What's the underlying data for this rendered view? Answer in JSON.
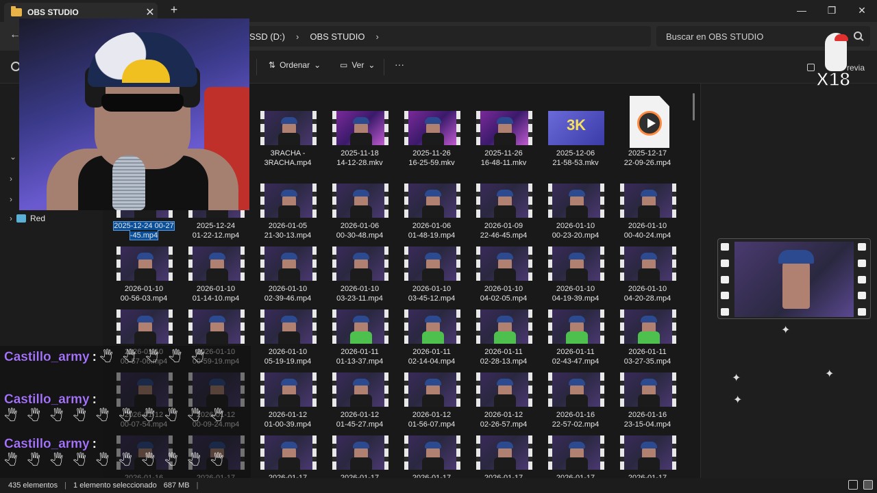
{
  "window": {
    "tab_title": "OBS STUDIO",
    "tab_close": "✕",
    "new_tab": "+",
    "minimize": "—",
    "maximize": "❐",
    "close": "✕"
  },
  "address": {
    "back": "←",
    "crumbs": [
      "SSD (D:)",
      "OBS STUDIO"
    ],
    "separator": "›",
    "search_placeholder": "Buscar en OBS STUDIO"
  },
  "toolbar": {
    "sort_label": "Ordenar",
    "view_label": "Ver",
    "more_label": "···",
    "preview_label": "revia"
  },
  "nav": {
    "network_label": "Red"
  },
  "files": [
    {
      "name": "3RACHA -\n3RACHA.mp4",
      "kind": "video"
    },
    {
      "name": "2025-11-18\n14-12-28.mkv",
      "kind": "pink"
    },
    {
      "name": "2025-11-26\n16-25-59.mkv",
      "kind": "pink"
    },
    {
      "name": "2025-11-26\n16-48-11.mkv",
      "kind": "pink"
    },
    {
      "name": "2025-12-06\n21-58-53.mkv",
      "kind": "badge",
      "badge": "3K"
    },
    {
      "name": "2025-12-17\n22-09-26.mp4",
      "kind": "doc"
    },
    {
      "name": "2025-12-24 00-27\n-45.mp4",
      "kind": "selected"
    },
    {
      "name": "2025-12-24\n01-22-12.mp4",
      "kind": "video"
    },
    {
      "name": "2026-01-05\n21-30-13.mp4",
      "kind": "video"
    },
    {
      "name": "2026-01-06\n00-30-48.mp4",
      "kind": "video"
    },
    {
      "name": "2026-01-06\n01-48-19.mp4",
      "kind": "video"
    },
    {
      "name": "2026-01-09\n22-46-45.mp4",
      "kind": "video"
    },
    {
      "name": "2026-01-10\n00-23-20.mp4",
      "kind": "video"
    },
    {
      "name": "2026-01-10\n00-40-24.mp4",
      "kind": "video"
    },
    {
      "name": "2026-01-10\n00-56-03.mp4",
      "kind": "video"
    },
    {
      "name": "2026-01-10\n01-14-10.mp4",
      "kind": "video"
    },
    {
      "name": "2026-01-10\n02-39-46.mp4",
      "kind": "video"
    },
    {
      "name": "2026-01-10\n03-23-11.mp4",
      "kind": "video"
    },
    {
      "name": "2026-01-10\n03-45-12.mp4",
      "kind": "video"
    },
    {
      "name": "2026-01-10\n04-02-05.mp4",
      "kind": "video"
    },
    {
      "name": "2026-01-10\n04-19-39.mp4",
      "kind": "video"
    },
    {
      "name": "2026-01-10\n04-20-28.mp4",
      "kind": "video"
    },
    {
      "name": "2026-01-10\n00-57-06.mp4",
      "kind": "video"
    },
    {
      "name": "2026-01-10\n00-59-19.mp4",
      "kind": "video"
    },
    {
      "name": "2026-01-10\n05-19-19.mp4",
      "kind": "video"
    },
    {
      "name": "2026-01-11\n01-13-37.mp4",
      "kind": "green"
    },
    {
      "name": "2026-01-11\n02-14-04.mp4",
      "kind": "green"
    },
    {
      "name": "2026-01-11\n02-28-13.mp4",
      "kind": "green"
    },
    {
      "name": "2026-01-11\n02-43-47.mp4",
      "kind": "green"
    },
    {
      "name": "2026-01-11\n03-27-35.mp4",
      "kind": "green"
    },
    {
      "name": "2026-01-12\n00-07-54.mp4",
      "kind": "video"
    },
    {
      "name": "2026-01-12\n00-09-24.mp4",
      "kind": "video"
    },
    {
      "name": "2026-01-12\n01-00-39.mp4",
      "kind": "video"
    },
    {
      "name": "2026-01-12\n01-45-27.mp4",
      "kind": "video"
    },
    {
      "name": "2026-01-12\n01-56-07.mp4",
      "kind": "video"
    },
    {
      "name": "2026-01-12\n02-26-57.mp4",
      "kind": "video"
    },
    {
      "name": "2026-01-16\n22-57-02.mp4",
      "kind": "video"
    },
    {
      "name": "2026-01-16\n23-15-04.mp4",
      "kind": "video"
    },
    {
      "name": "2026-01-16",
      "kind": "video"
    },
    {
      "name": "2026-01-17",
      "kind": "video"
    },
    {
      "name": "2026-01-17",
      "kind": "video"
    },
    {
      "name": "2026-01-17",
      "kind": "video"
    },
    {
      "name": "2026-01-17",
      "kind": "video"
    },
    {
      "name": "2026-01-17",
      "kind": "video"
    },
    {
      "name": "2026-01-17",
      "kind": "video"
    },
    {
      "name": "2026-01-17",
      "kind": "video"
    }
  ],
  "status": {
    "count": "435 elementos",
    "selection": "1 elemento seleccionado",
    "size": "687 MB",
    "sep": "|"
  },
  "chat": [
    {
      "user": "Castillo_army",
      "colon": ":",
      "emotes": "🖑🖑🖑🖑🖑"
    },
    {
      "user": "Castillo_army",
      "colon": ":",
      "emotes": "🖑🖑🖑🖑🖑🖑🖑🖑🖑🖑"
    },
    {
      "user": "Castillo_army",
      "colon": ":",
      "emotes": "🖑🖑🖑🖑🖑🖑🖑🖑🖑🖑"
    }
  ],
  "overlay_logo": {
    "text": "X18"
  },
  "colors": {
    "accent_select": "#0a4f9a",
    "chat_user": "#a877ff",
    "folder": "#e8b44a"
  }
}
